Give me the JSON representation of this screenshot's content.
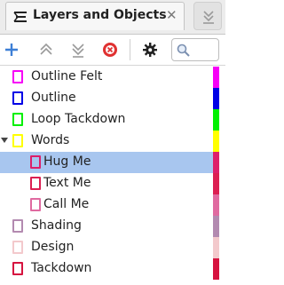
{
  "panel": {
    "title": "Layers and Objects",
    "close_glyph": "✕"
  },
  "toolbar": {
    "buttons": [
      {
        "name": "add-layer",
        "icon": "plus-icon",
        "color": "#3d7fd6"
      },
      {
        "name": "raise-layer",
        "icon": "raise-layer-icon",
        "color": "#9a9a9a"
      },
      {
        "name": "lower-layer",
        "icon": "lower-layer-icon",
        "color": "#9a9a9a"
      },
      {
        "name": "delete-layer",
        "icon": "delete-icon",
        "color": "#e03131"
      },
      {
        "name": "layer-properties",
        "icon": "gear-icon",
        "color": "#222222"
      }
    ],
    "search_icon": "search-icon"
  },
  "layers": [
    {
      "label": "Outline Felt",
      "color": "#f700f7",
      "indent": 0,
      "selected": false,
      "expanded": null
    },
    {
      "label": "Outline",
      "color": "#0000e6",
      "indent": 0,
      "selected": false,
      "expanded": null
    },
    {
      "label": "Loop Tackdown",
      "color": "#00f000",
      "indent": 0,
      "selected": false,
      "expanded": null
    },
    {
      "label": "Words",
      "color": "#ffff00",
      "indent": 0,
      "selected": false,
      "expanded": true
    },
    {
      "label": "Hug Me",
      "color": "#dd1f6a",
      "indent": 1,
      "selected": true,
      "expanded": null
    },
    {
      "label": "Text Me",
      "color": "#dc1f52",
      "indent": 1,
      "selected": false,
      "expanded": null
    },
    {
      "label": "Call Me",
      "color": "#e06aa0",
      "indent": 1,
      "selected": false,
      "expanded": null
    },
    {
      "label": "Shading",
      "color": "#b38ab0",
      "indent": 0,
      "selected": false,
      "expanded": null
    },
    {
      "label": "Design",
      "color": "#f3c9cc",
      "indent": 0,
      "selected": false,
      "expanded": null
    },
    {
      "label": "Tackdown",
      "color": "#d6133f",
      "indent": 0,
      "selected": false,
      "expanded": null
    }
  ]
}
